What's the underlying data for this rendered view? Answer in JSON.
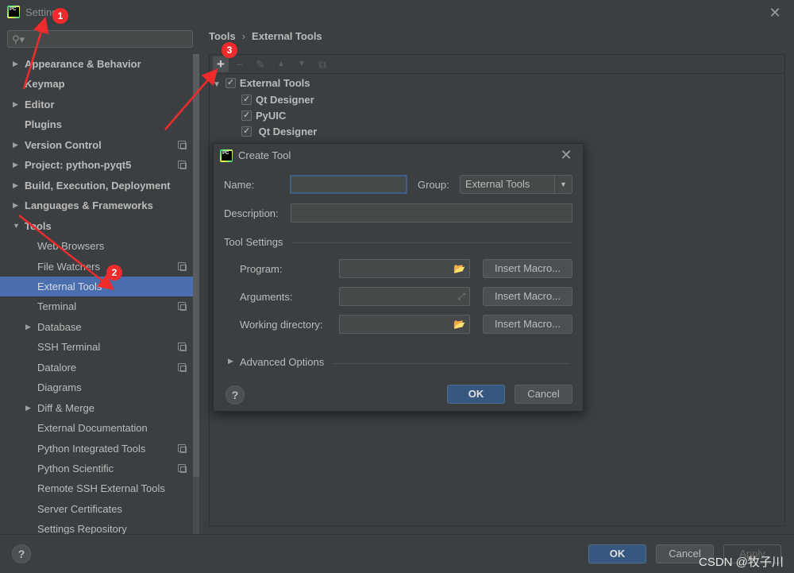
{
  "window": {
    "title": "Settings",
    "close_icon": "close-icon"
  },
  "sidebar": {
    "search_placeholder": "",
    "items": [
      {
        "label": "Appearance & Behavior",
        "level": 0,
        "expandable": true,
        "expanded": false,
        "bold": true,
        "project_icon": false
      },
      {
        "label": "Keymap",
        "level": 0,
        "expandable": false,
        "bold": true,
        "project_icon": false
      },
      {
        "label": "Editor",
        "level": 0,
        "expandable": true,
        "expanded": false,
        "bold": true,
        "project_icon": false
      },
      {
        "label": "Plugins",
        "level": 0,
        "expandable": false,
        "bold": true,
        "project_icon": false
      },
      {
        "label": "Version Control",
        "level": 0,
        "expandable": true,
        "expanded": false,
        "bold": true,
        "project_icon": true
      },
      {
        "label": "Project: python-pyqt5",
        "level": 0,
        "expandable": true,
        "expanded": false,
        "bold": true,
        "project_icon": true
      },
      {
        "label": "Build, Execution, Deployment",
        "level": 0,
        "expandable": true,
        "expanded": false,
        "bold": true,
        "project_icon": false
      },
      {
        "label": "Languages & Frameworks",
        "level": 0,
        "expandable": true,
        "expanded": false,
        "bold": true,
        "project_icon": false
      },
      {
        "label": "Tools",
        "level": 0,
        "expandable": true,
        "expanded": true,
        "bold": true,
        "project_icon": false
      },
      {
        "label": "Web Browsers",
        "level": 1,
        "expandable": false,
        "project_icon": false
      },
      {
        "label": "File Watchers",
        "level": 1,
        "expandable": false,
        "project_icon": true
      },
      {
        "label": "External Tools",
        "level": 1,
        "expandable": false,
        "project_icon": false,
        "selected": true
      },
      {
        "label": "Terminal",
        "level": 1,
        "expandable": false,
        "project_icon": true
      },
      {
        "label": "Database",
        "level": 1,
        "expandable": true,
        "expanded": false,
        "project_icon": false
      },
      {
        "label": "SSH Terminal",
        "level": 1,
        "expandable": false,
        "project_icon": true
      },
      {
        "label": "Datalore",
        "level": 1,
        "expandable": false,
        "project_icon": true
      },
      {
        "label": "Diagrams",
        "level": 1,
        "expandable": false,
        "project_icon": false
      },
      {
        "label": "Diff & Merge",
        "level": 1,
        "expandable": true,
        "expanded": false,
        "project_icon": false
      },
      {
        "label": "External Documentation",
        "level": 1,
        "expandable": false,
        "project_icon": false
      },
      {
        "label": "Python Integrated Tools",
        "level": 1,
        "expandable": false,
        "project_icon": true
      },
      {
        "label": "Python Scientific",
        "level": 1,
        "expandable": false,
        "project_icon": true
      },
      {
        "label": "Remote SSH External Tools",
        "level": 1,
        "expandable": false,
        "project_icon": false
      },
      {
        "label": "Server Certificates",
        "level": 1,
        "expandable": false,
        "project_icon": false
      },
      {
        "label": "Settings Repository",
        "level": 1,
        "expandable": false,
        "project_icon": false
      }
    ]
  },
  "breadcrumb": {
    "parent": "Tools",
    "separator": "›",
    "current": "External Tools"
  },
  "toolbar": {
    "add": "+",
    "remove": "−",
    "edit": "✎",
    "move_up": "▲",
    "move_down": "▼",
    "copy": "⧉"
  },
  "tools_tree": {
    "group": {
      "label": "External Tools",
      "checked": true,
      "expanded": true
    },
    "items": [
      {
        "label": "Qt Designer",
        "checked": true
      },
      {
        "label": "PyUIC",
        "checked": true
      },
      {
        "label": " Qt Designer",
        "checked": true
      }
    ]
  },
  "dialog": {
    "title": "Create Tool",
    "name_label": "Name:",
    "name_value": "",
    "group_label": "Group:",
    "group_value": "External Tools",
    "description_label": "Description:",
    "description_value": "",
    "tool_settings_label": "Tool Settings",
    "program_label": "Program:",
    "program_value": "",
    "arguments_label": "Arguments:",
    "arguments_value": "",
    "working_dir_label": "Working directory:",
    "working_dir_value": "",
    "insert_macro": "Insert Macro...",
    "advanced_options": "Advanced Options",
    "ok": "OK",
    "cancel": "Cancel",
    "help": "?"
  },
  "footer": {
    "ok": "OK",
    "cancel": "Cancel",
    "apply": "Apply",
    "help": "?"
  },
  "annotations": {
    "badge1": "1",
    "badge2": "2",
    "badge3": "3",
    "color": "#f02b2b"
  },
  "watermark": "CSDN @牧子川",
  "colors": {
    "selection": "#4b6eaf",
    "primary_button": "#365880",
    "background": "#3c3f41"
  }
}
